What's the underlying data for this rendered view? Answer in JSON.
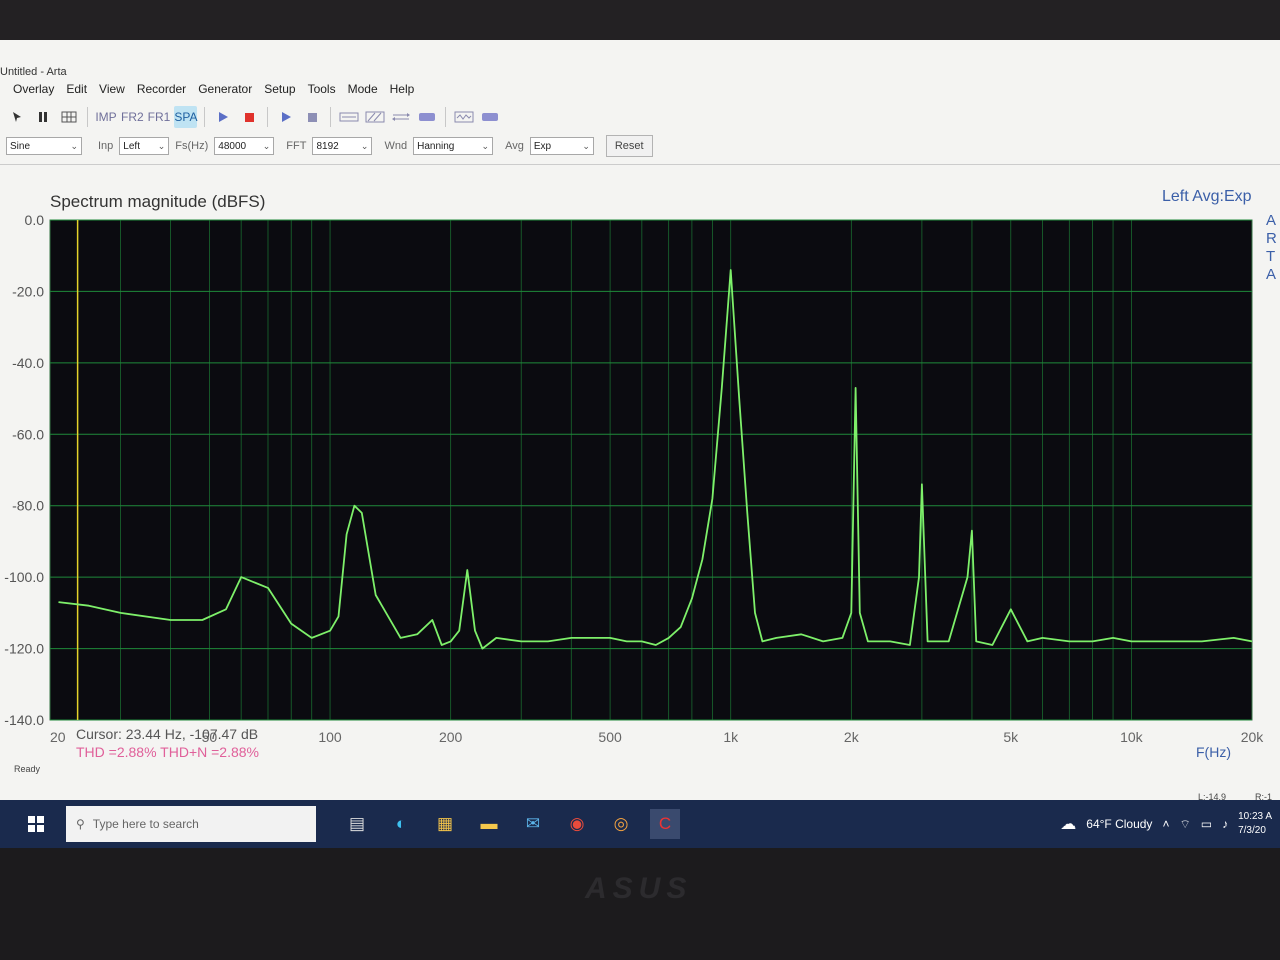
{
  "window": {
    "title": "Untitled - Arta"
  },
  "menu": [
    "Overlay",
    "Edit",
    "View",
    "Recorder",
    "Generator",
    "Setup",
    "Tools",
    "Mode",
    "Help"
  ],
  "toolbar": {
    "imp": "IMP",
    "fr2": "FR2",
    "fr1": "FR1",
    "spa": "SPA"
  },
  "controls": {
    "signal": "Sine",
    "inp_label": "Inp",
    "inp": "Left",
    "fs_label": "Fs(Hz)",
    "fs": "48000",
    "fft_label": "FFT",
    "fft": "8192",
    "wnd_label": "Wnd",
    "wnd": "Hanning",
    "avg_label": "Avg",
    "avg": "Exp",
    "reset": "Reset"
  },
  "chart_header": {
    "title": "Spectrum magnitude (dBFS)",
    "right": "Left   Avg:Exp",
    "side_letters": [
      "A",
      "R",
      "T",
      "A"
    ]
  },
  "readout": {
    "cursor": "Cursor: 23.44 Hz, -107.47 dB",
    "thd": "THD =2.88%   THD+N =2.88%",
    "freq_unit": "F(Hz)"
  },
  "status": {
    "left": "Ready",
    "l_level": "L:-14.9",
    "r_level": "R:-1"
  },
  "taskbar": {
    "search_placeholder": "Type here to search",
    "weather": "64°F  Cloudy",
    "time": "10:23 A",
    "date": "7/3/20"
  },
  "colors": {
    "plot_bg": "#0b0b10",
    "grid": "#1f8a3a",
    "trace": "#7ef06a",
    "cursor": "#e5d22a",
    "accent": "#3b5fa8"
  },
  "chart_data": {
    "type": "line",
    "title": "Spectrum magnitude (dBFS)",
    "xlabel": "F(Hz)",
    "ylabel": "",
    "x_scale": "log",
    "xlim": [
      20,
      20000
    ],
    "ylim": [
      -140,
      0
    ],
    "grid": true,
    "y_ticks": [
      "0.0",
      "-20.0",
      "-40.0",
      "-60.0",
      "-80.0",
      "-100.0",
      "-120.0",
      "-140.0"
    ],
    "y_tick_values": [
      0,
      -20,
      -40,
      -60,
      -80,
      -100,
      -120,
      -140
    ],
    "x_tick_labels": [
      "20",
      "50",
      "100",
      "200",
      "500",
      "1k",
      "2k",
      "5k",
      "10k",
      "20k"
    ],
    "x_tick_values": [
      20,
      50,
      100,
      200,
      500,
      1000,
      2000,
      5000,
      10000,
      20000
    ],
    "cursor_hz": 23.44,
    "series": [
      {
        "x": [
          21,
          25,
          30,
          40,
          48,
          55,
          60,
          70,
          80,
          90,
          100,
          105,
          110,
          115,
          120,
          130,
          150,
          165,
          180,
          190,
          200,
          210,
          220,
          230,
          240,
          260,
          300,
          350,
          400,
          450,
          500,
          550,
          600,
          650,
          700,
          750,
          800,
          850,
          900,
          950,
          1000,
          1050,
          1100,
          1150,
          1200,
          1300,
          1500,
          1700,
          1900,
          2000,
          2050,
          2100,
          2200,
          2500,
          2800,
          2950,
          3000,
          3100,
          3500,
          3900,
          4000,
          4100,
          4500,
          5000,
          5500,
          6000,
          7000,
          8000,
          9000,
          10000,
          12000,
          15000,
          18000,
          20000
        ],
        "y": [
          -107,
          -108,
          -110,
          -112,
          -112,
          -109,
          -100,
          -103,
          -113,
          -117,
          -115,
          -111,
          -88,
          -80,
          -82,
          -105,
          -117,
          -116,
          -112,
          -119,
          -118,
          -115,
          -98,
          -115,
          -120,
          -117,
          -118,
          -118,
          -117,
          -117,
          -117,
          -118,
          -118,
          -119,
          -117,
          -114,
          -106,
          -95,
          -78,
          -47,
          -14,
          -50,
          -82,
          -110,
          -118,
          -117,
          -116,
          -118,
          -117,
          -110,
          -47,
          -110,
          -118,
          -118,
          -119,
          -100,
          -74,
          -118,
          -118,
          -100,
          -87,
          -118,
          -119,
          -109,
          -118,
          -117,
          -118,
          -118,
          -117,
          -118,
          -118,
          -118,
          -117,
          -118
        ]
      }
    ]
  }
}
